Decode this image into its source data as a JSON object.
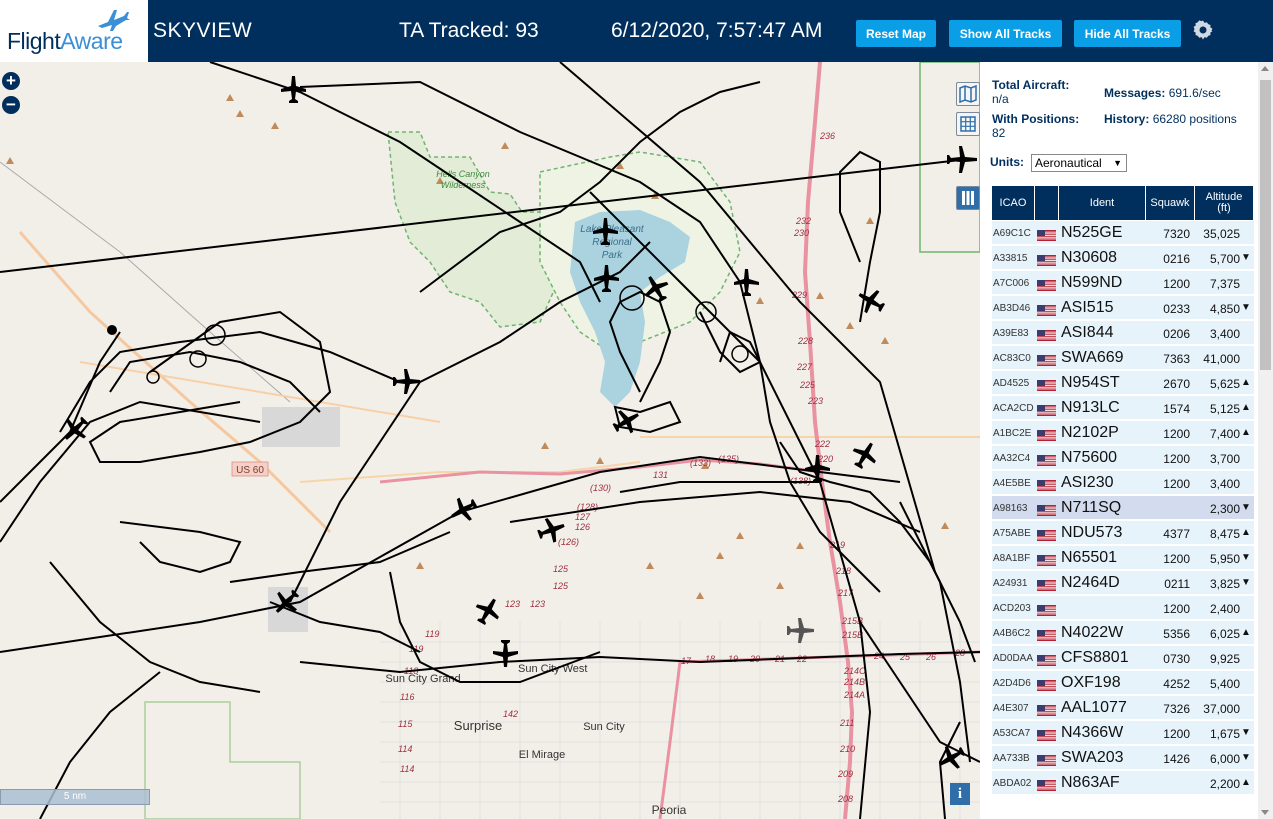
{
  "header": {
    "logo_flight": "Flight",
    "logo_aware": "Aware",
    "app_title": "SKYVIEW",
    "tracked_label": "TA Tracked: 93",
    "datetime": "6/12/2020, 7:57:47 AM",
    "reset_label": "Reset Map",
    "show_tracks_label": "Show All Tracks",
    "hide_tracks_label": "Hide All Tracks",
    "settings_icon": "gear-icon"
  },
  "map": {
    "zoom_in": "+",
    "zoom_out": "−",
    "scale_label": "5 nm",
    "info_label": "i",
    "place_labels": [
      "Hells Canyon",
      "Wilderness",
      "Lake Pleasant",
      "Regional",
      "Park",
      "Sun City West",
      "Sun City Grand",
      "Surprise",
      "Sun City",
      "El Mirage",
      "Peoria",
      "US 60"
    ],
    "route_labels": [
      "236",
      "232",
      "230",
      "229",
      "228",
      "227",
      "225",
      "223",
      "222",
      "220",
      "219",
      "218",
      "217",
      "215B",
      "215B",
      "214C",
      "214B",
      "214A",
      "211",
      "210",
      "209",
      "208",
      "(128)",
      "(126)",
      "(130)",
      "131",
      "(133)",
      "(135)",
      "(138)",
      "127",
      "126",
      "125",
      "125",
      "123",
      "123",
      "119",
      "119",
      "118",
      "116",
      "115",
      "114",
      "114",
      "142",
      "24",
      "25",
      "26",
      "28",
      "17",
      "18",
      "19",
      "20",
      "21",
      "22"
    ],
    "colors": {
      "land": "#f2efe9",
      "water": "#aad3df",
      "park": "#c8e6b8",
      "track": "#000000",
      "highway": "#e892a2",
      "road": "#ffffff",
      "boundary": "#6fb56f"
    }
  },
  "sidebar": {
    "total_aircraft_label": "Total Aircraft:",
    "total_aircraft_value": "n/a",
    "messages_label": "Messages:",
    "messages_value": "691.6/sec",
    "with_positions_label": "With Positions:",
    "with_positions_value": "82",
    "history_label": "History:",
    "history_value": "66280 positions",
    "units_label": "Units:",
    "units_value": "Aeronautical",
    "columns": [
      "ICAO",
      "",
      "Ident",
      "Squawk",
      "Altitude (ft)"
    ],
    "rows": [
      {
        "icao": "A69C1C",
        "ident": "N525GE",
        "squawk": "7320",
        "alt": "35,025",
        "trend": ""
      },
      {
        "icao": "A33815",
        "ident": "N30608",
        "squawk": "0216",
        "alt": "5,700",
        "trend": "▼"
      },
      {
        "icao": "A7C006",
        "ident": "N599ND",
        "squawk": "1200",
        "alt": "7,375",
        "trend": ""
      },
      {
        "icao": "AB3D46",
        "ident": "ASI515",
        "squawk": "0233",
        "alt": "4,850",
        "trend": "▼"
      },
      {
        "icao": "A39E83",
        "ident": "ASI844",
        "squawk": "0206",
        "alt": "3,400",
        "trend": ""
      },
      {
        "icao": "AC83C0",
        "ident": "SWA669",
        "squawk": "7363",
        "alt": "41,000",
        "trend": ""
      },
      {
        "icao": "AD4525",
        "ident": "N954ST",
        "squawk": "2670",
        "alt": "5,625",
        "trend": "▲"
      },
      {
        "icao": "ACA2CD",
        "ident": "N913LC",
        "squawk": "1574",
        "alt": "5,125",
        "trend": "▲"
      },
      {
        "icao": "A1BC2E",
        "ident": "N2102P",
        "squawk": "1200",
        "alt": "7,400",
        "trend": "▲"
      },
      {
        "icao": "AA32C4",
        "ident": "N75600",
        "squawk": "1200",
        "alt": "3,700",
        "trend": ""
      },
      {
        "icao": "A4E5BE",
        "ident": "ASI230",
        "squawk": "1200",
        "alt": "3,400",
        "trend": ""
      },
      {
        "icao": "A98163",
        "ident": "N711SQ",
        "squawk": "",
        "alt": "2,300",
        "trend": "▼"
      },
      {
        "icao": "A75ABE",
        "ident": "NDU573",
        "squawk": "4377",
        "alt": "8,475",
        "trend": "▲"
      },
      {
        "icao": "A8A1BF",
        "ident": "N65501",
        "squawk": "1200",
        "alt": "5,950",
        "trend": "▼"
      },
      {
        "icao": "A24931",
        "ident": "N2464D",
        "squawk": "0211",
        "alt": "3,825",
        "trend": "▼"
      },
      {
        "icao": "ACD203",
        "ident": "",
        "squawk": "1200",
        "alt": "2,400",
        "trend": ""
      },
      {
        "icao": "A4B6C2",
        "ident": "N4022W",
        "squawk": "5356",
        "alt": "6,025",
        "trend": "▲"
      },
      {
        "icao": "AD0DAA",
        "ident": "CFS8801",
        "squawk": "0730",
        "alt": "9,925",
        "trend": ""
      },
      {
        "icao": "A2D4D6",
        "ident": "OXF198",
        "squawk": "4252",
        "alt": "5,400",
        "trend": ""
      },
      {
        "icao": "A4E307",
        "ident": "AAL1077",
        "squawk": "7326",
        "alt": "37,000",
        "trend": ""
      },
      {
        "icao": "A53CA7",
        "ident": "N4366W",
        "squawk": "1200",
        "alt": "1,675",
        "trend": "▼"
      },
      {
        "icao": "AA733B",
        "ident": "SWA203",
        "squawk": "1426",
        "alt": "6,000",
        "trend": "▼"
      },
      {
        "icao": "ABDA02",
        "ident": "N863AF",
        "squawk": "",
        "alt": "2,200",
        "trend": "▲"
      }
    ]
  }
}
